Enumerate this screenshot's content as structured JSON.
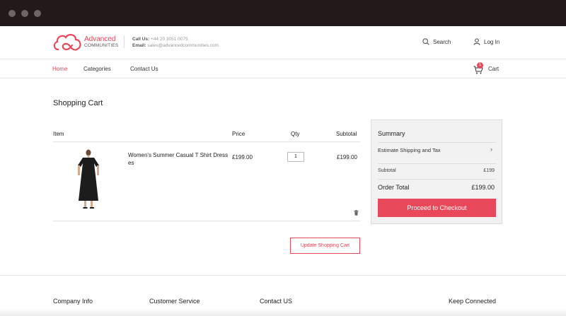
{
  "header": {
    "logo_line1": "Advanced",
    "logo_line2": "COMMUNITIES",
    "call_label": "Call Us:",
    "call_value": "+44 20 3051 0075",
    "email_label": "Email:",
    "email_value": "sales@advancedcommunities.com",
    "search_label": "Search",
    "login_label": "Log In"
  },
  "nav": {
    "items": [
      {
        "label": "Home"
      },
      {
        "label": "Categories"
      },
      {
        "label": "Contact Us"
      }
    ],
    "cart_label": "Cart",
    "cart_count": "1"
  },
  "page": {
    "title": "Shopping Cart"
  },
  "cart": {
    "columns": {
      "item": "Item",
      "price": "Price",
      "qty": "Qty",
      "subtotal": "Subtotal"
    },
    "rows": [
      {
        "name": "Women's Summer Casual T Shirt Dresses",
        "price": "£199.00",
        "qty": "1",
        "subtotal": "£199.00"
      }
    ],
    "update_label": "Update Shopping Cart"
  },
  "summary": {
    "title": "Summary",
    "estimate_label": "Estimate Shipping and Tax",
    "subtotal_label": "Subtotal",
    "subtotal_value": "£199",
    "total_label": "Order Total",
    "total_value": "£199.00",
    "checkout_label": "Proceed to Checkout"
  },
  "footer": {
    "columns": [
      {
        "title": "Company Info"
      },
      {
        "title": "Customer Service"
      },
      {
        "title": "Contact US"
      },
      {
        "title": "Keep Connected"
      }
    ]
  },
  "colors": {
    "accent": "#e8485a",
    "titlebar": "#221a1a",
    "summary_bg": "#f2f2f2"
  },
  "icons": [
    "logo-cloud-icon",
    "search-icon",
    "user-icon",
    "cart-icon",
    "chevron-right-icon",
    "trash-icon"
  ]
}
